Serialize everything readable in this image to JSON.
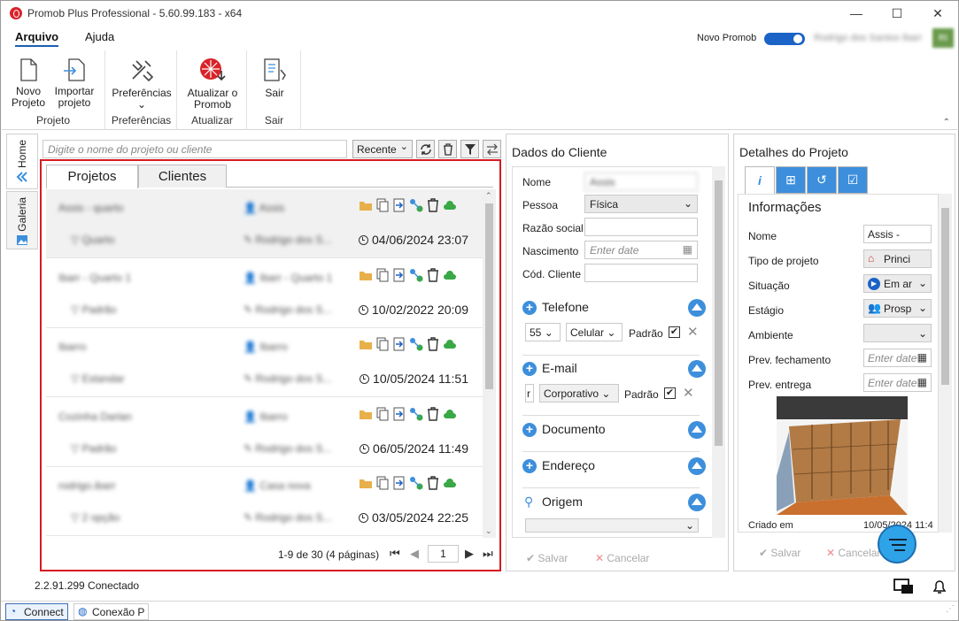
{
  "window": {
    "title": "Promob Plus Professional - 5.60.99.183 - x64",
    "controls": [
      "minimize-icon",
      "maximize-icon",
      "close-icon"
    ]
  },
  "menu": {
    "items": [
      "Arquivo",
      "Ajuda"
    ],
    "novo_promob_label": "Novo Promob",
    "novo_promob_on": true,
    "user_name": "Rodrigo dos Santos Ibarr",
    "user_initials": "RI"
  },
  "ribbon": {
    "groups": [
      {
        "label": "Projeto",
        "buttons": [
          "Novo\nProjeto",
          "Importar\nprojeto"
        ]
      },
      {
        "label": "Preferências",
        "buttons": [
          "Preferências\n⌄"
        ]
      },
      {
        "label": "Atualizar",
        "buttons": [
          "Atualizar o\nPromob"
        ]
      },
      {
        "label": "Sair",
        "buttons": [
          "Sair"
        ]
      }
    ]
  },
  "sidetabs": [
    "Home",
    "Galeria"
  ],
  "search": {
    "placeholder": "Digite o nome do projeto ou cliente",
    "sort_value": "Recente"
  },
  "projects_panel": {
    "tabs": [
      "Projetos",
      "Clientes"
    ],
    "rows": [
      {
        "name": "Assis - quarto",
        "folder": "Quarto",
        "client": "Assis",
        "owner": "Rodrigo dos S...",
        "date": "04/06/2024 23:07"
      },
      {
        "name": "Ibarr - Quarto 1",
        "folder": "Padrão",
        "client": "Ibarr - Quarto 1",
        "owner": "Rodrigo dos S...",
        "date": "10/02/2022 20:09"
      },
      {
        "name": "Ibarro",
        "folder": "Estandar",
        "client": "Ibarro",
        "owner": "Rodrigo dos S...",
        "date": "10/05/2024 11:51"
      },
      {
        "name": "Cozinha Darlan",
        "folder": "Padrão",
        "client": "Ibarro",
        "owner": "Rodrigo dos S...",
        "date": "06/05/2024 11:49"
      },
      {
        "name": "rodrigo.ibarr",
        "folder": "2 opção",
        "client": "Casa nova",
        "owner": "Rodrigo dos S...",
        "date": "03/05/2024 22:25"
      }
    ],
    "pagination": {
      "info": "1-9 de 30 (4 páginas)",
      "page": "1"
    }
  },
  "client_panel": {
    "title": "Dados do Cliente",
    "fields": {
      "nome_label": "Nome",
      "nome_value": "Assis",
      "pessoa_label": "Pessoa",
      "pessoa_value": "Física",
      "razao_label": "Razão social",
      "nascimento_label": "Nascimento",
      "nascimento_placeholder": "Enter date",
      "cod_label": "Cód. Cliente"
    },
    "sections": {
      "telefone": "Telefone",
      "email": "E-mail",
      "documento": "Documento",
      "endereco": "Endereço",
      "origem": "Origem"
    },
    "telefone_row": {
      "ddi": "55",
      "tipo": "Celular",
      "padrao": "Padrão",
      "checked": true
    },
    "email_row": {
      "value": "r",
      "tipo": "Corporativo",
      "padrao": "Padrão",
      "checked": true
    },
    "buttons": {
      "save": "Salvar",
      "cancel": "Cancelar"
    }
  },
  "details_panel": {
    "title": "Detalhes do Projeto",
    "section": "Informações",
    "labels": {
      "nome": "Nome",
      "tipo": "Tipo de projeto",
      "situacao": "Situação",
      "estagio": "Estágio",
      "ambiente": "Ambiente",
      "prev_fechamento": "Prev. fechamento",
      "prev_entrega": "Prev. entrega",
      "criado": "Criado em"
    },
    "values": {
      "nome": "Assis -",
      "tipo": "Princi",
      "situacao": "Em ar",
      "estagio": "Prosp",
      "date_placeholder": "Enter date",
      "criado": "10/05/2024 11:4"
    },
    "buttons": {
      "save": "Salvar",
      "cancel": "Cancelar"
    }
  },
  "status": {
    "text": "2.2.91.299  Conectado"
  },
  "bottom_tabs": [
    "Connect",
    "Conexão P"
  ],
  "colors": {
    "accent": "#3d8fdc",
    "highlight": "#d61b22"
  }
}
